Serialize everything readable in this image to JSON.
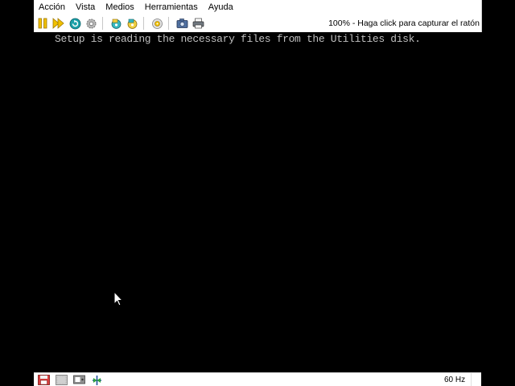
{
  "menu": {
    "items": [
      "Acción",
      "Vista",
      "Medios",
      "Herramientas",
      "Ayuda"
    ]
  },
  "toolbar": {
    "buttons": [
      {
        "icon": "pause-icon"
      },
      {
        "icon": "fast-forward-icon"
      },
      {
        "icon": "reset-icon"
      },
      {
        "icon": "settings-gear-icon"
      },
      {
        "icon": "floppy-drive-a-icon"
      },
      {
        "icon": "floppy-drive-b-icon"
      },
      {
        "icon": "cdrom-icon"
      },
      {
        "icon": "screenshot-camera-icon"
      },
      {
        "icon": "printer-icon"
      }
    ],
    "status_text": "100% - Haga click para capturar el ratón"
  },
  "screen": {
    "line": "Setup is reading the necessary files from the Utilities disk."
  },
  "statusbar": {
    "refresh_rate": "60 Hz"
  },
  "colors": {
    "screen_background": "#000000",
    "screen_text": "#bfbfbf",
    "chrome_background": "#ffffff",
    "pause_yellow": "#f0c000",
    "play_yellow": "#f0c000",
    "reset_teal": "#1aa0a8"
  }
}
